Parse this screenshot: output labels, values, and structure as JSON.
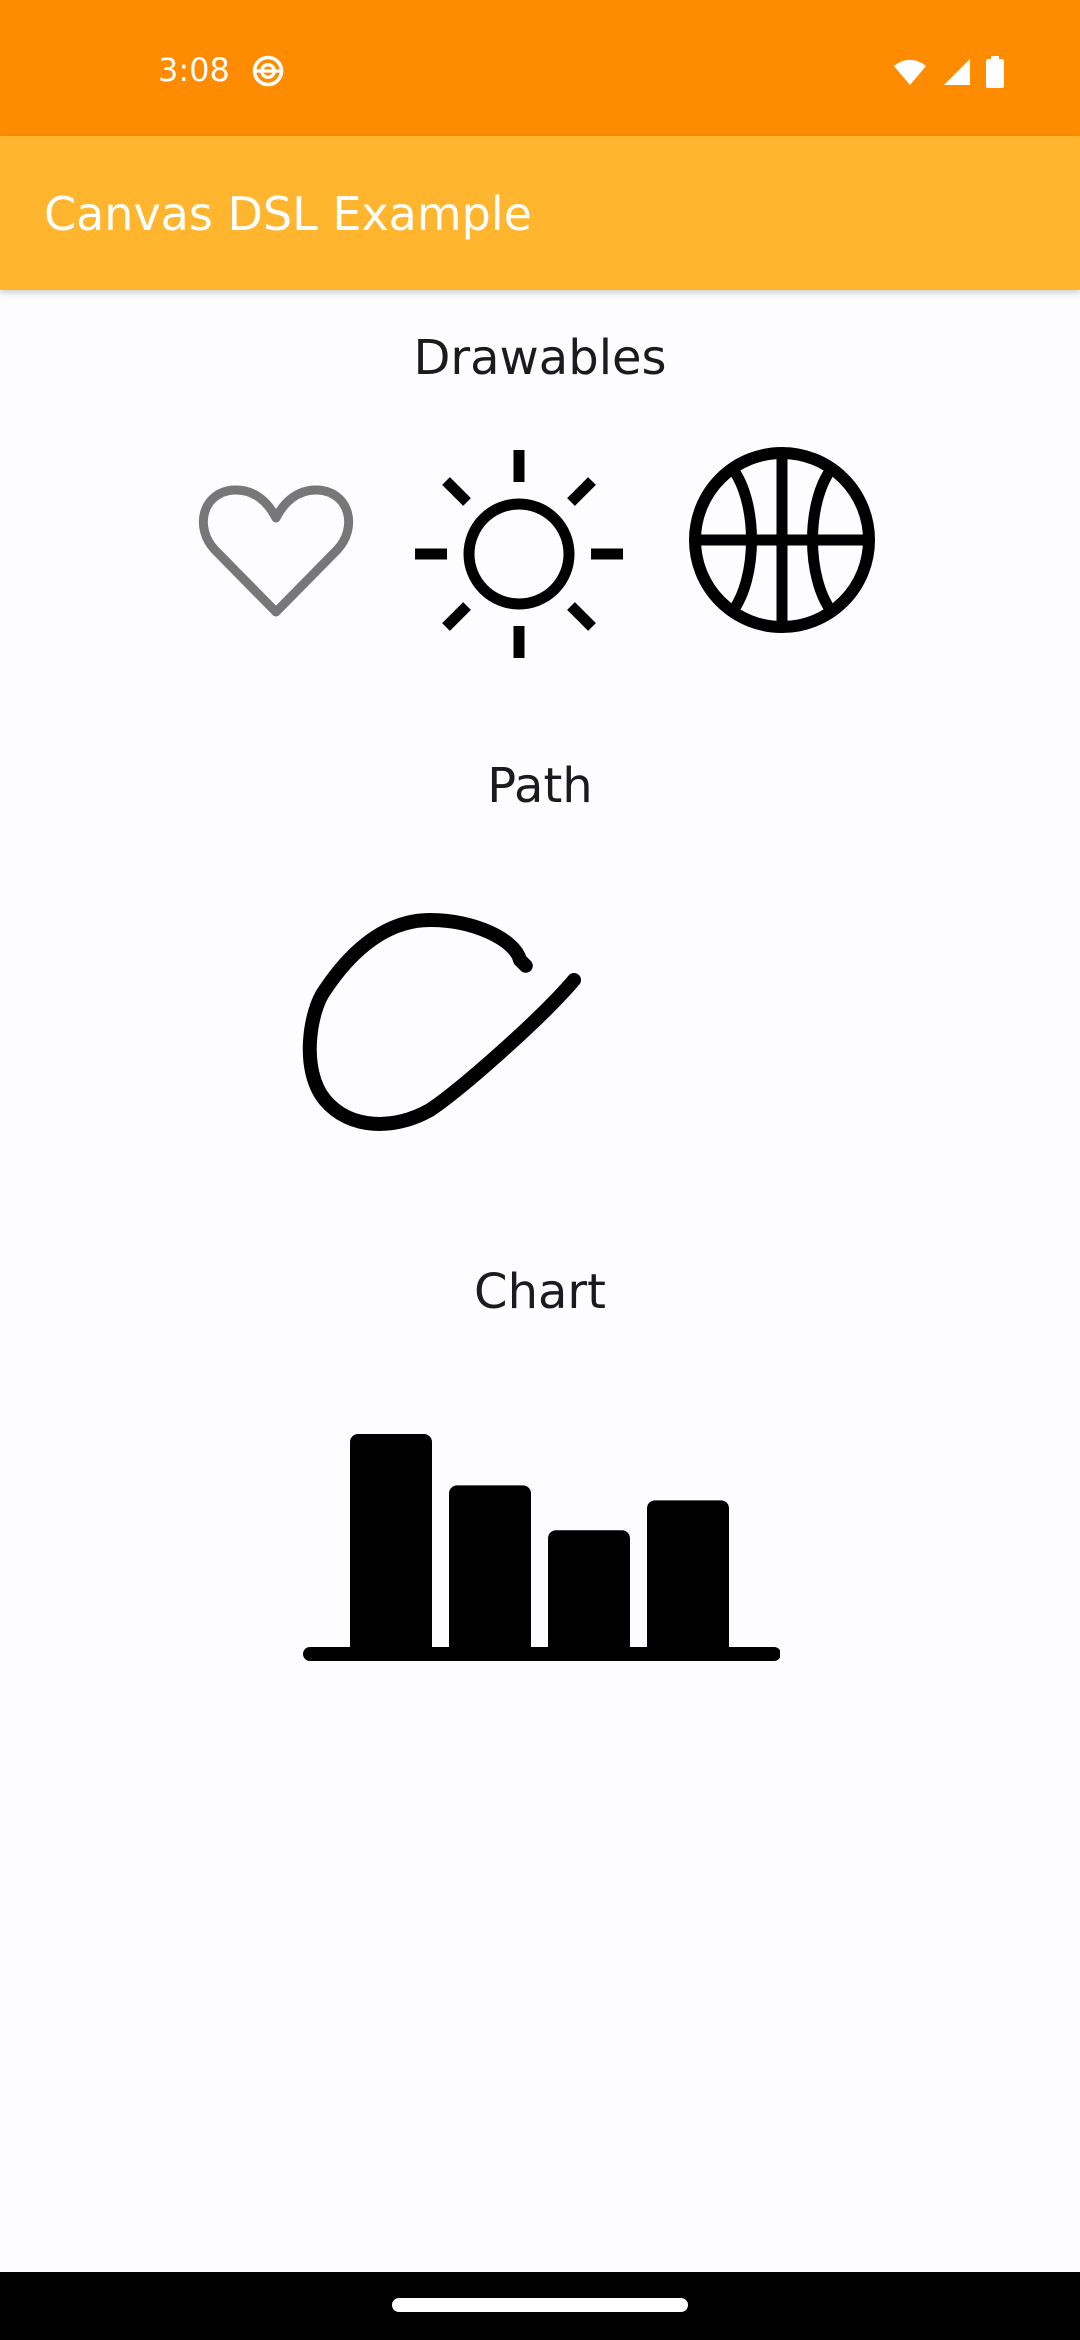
{
  "status_bar": {
    "time": "3:08",
    "icons": [
      "sync-icon",
      "wifi-icon",
      "cell-signal-icon",
      "battery-icon"
    ]
  },
  "app_bar": {
    "title": "Canvas DSL Example"
  },
  "sections": {
    "drawables": {
      "title": "Drawables",
      "icons": [
        "heart-outline-icon",
        "sun-icon",
        "basketball-icon"
      ]
    },
    "path": {
      "title": "Path"
    },
    "chart": {
      "title": "Chart"
    }
  },
  "chart_data": {
    "type": "bar",
    "categories": [
      "",
      "",
      "",
      ""
    ],
    "values": [
      100,
      76,
      55,
      69
    ],
    "title": "",
    "xlabel": "",
    "ylabel": "",
    "ylim": [
      0,
      100
    ],
    "grid": false,
    "color": "#000000"
  },
  "colors": {
    "status_bar": "#ff8c00",
    "app_bar": "#ffb52e",
    "background": "#fdfcff",
    "heart": "#777777",
    "ink": "#000000"
  }
}
